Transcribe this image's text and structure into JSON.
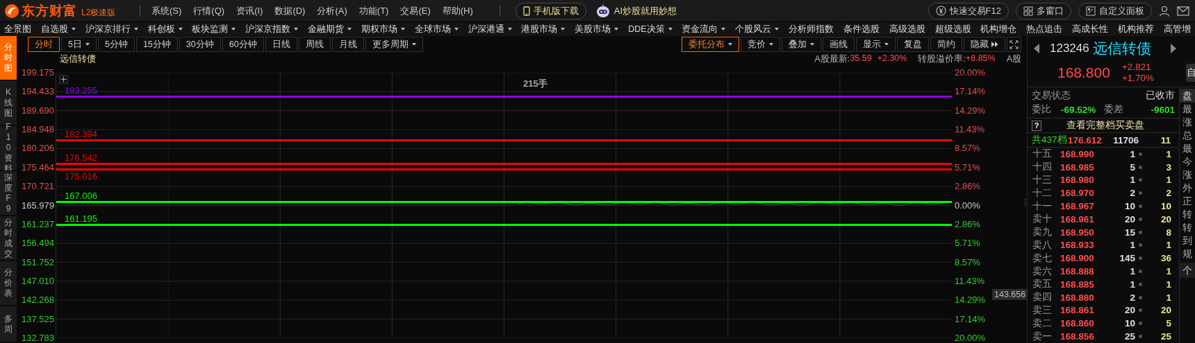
{
  "app": {
    "logo_text": "东方财富",
    "edition": "L2极速版"
  },
  "menu": [
    "系统(S)",
    "行情(Q)",
    "资讯(I)",
    "数据(D)",
    "分析(A)",
    "功能(T)",
    "交易(E)",
    "帮助(H)"
  ],
  "promo_buttons": [
    {
      "label": "手机版下载",
      "kind": "phone"
    },
    {
      "label": "AI炒股就用妙想",
      "kind": "robot"
    }
  ],
  "tool_buttons": [
    {
      "label": "快速交易F12",
      "kind": "trade"
    },
    {
      "label": "多窗口",
      "kind": "windows"
    },
    {
      "label": "自定义面板",
      "kind": "panel"
    }
  ],
  "nav": [
    {
      "label": "全景图",
      "dropdown": false
    },
    {
      "label": "自选股",
      "dropdown": true
    },
    {
      "label": "沪深京排行",
      "dropdown": true
    },
    {
      "label": "科创板",
      "dropdown": true
    },
    {
      "label": "板块监测",
      "dropdown": true
    },
    {
      "label": "沪深京指数",
      "dropdown": true
    },
    {
      "label": "金融期货",
      "dropdown": true
    },
    {
      "label": "期权市场",
      "dropdown": true
    },
    {
      "label": "全球市场",
      "dropdown": true
    },
    {
      "label": "沪深港通",
      "dropdown": true
    },
    {
      "label": "港股市场",
      "dropdown": true
    },
    {
      "label": "美股市场",
      "dropdown": true
    },
    {
      "label": "DDE决策",
      "dropdown": true
    },
    {
      "label": "资金流向",
      "dropdown": true
    },
    {
      "label": "个股风云",
      "dropdown": true
    },
    {
      "label": "分析师指数",
      "dropdown": false
    },
    {
      "label": "条件选股",
      "dropdown": false
    },
    {
      "label": "高级选股",
      "dropdown": false
    },
    {
      "label": "超级选股",
      "dropdown": false
    },
    {
      "label": "机构增仓",
      "dropdown": false
    },
    {
      "label": "热点追击",
      "dropdown": false
    },
    {
      "label": "高成长性",
      "dropdown": false
    },
    {
      "label": "机构推荐",
      "dropdown": false
    },
    {
      "label": "高管增",
      "dropdown": false
    }
  ],
  "sidebar_tabs": [
    {
      "label": "分时图",
      "selected": true
    },
    {
      "label": "K线图",
      "selected": false
    },
    {
      "label": "F10资料",
      "selected": false
    },
    {
      "label": "深度F9",
      "selected": false
    },
    {
      "label": "分时成交",
      "selected": false
    },
    {
      "label": "分价表",
      "selected": false
    },
    {
      "label": "多周",
      "selected": false
    }
  ],
  "periods": [
    {
      "label": "分时",
      "selected": true,
      "dropdown": false
    },
    {
      "label": "5日",
      "selected": false,
      "dropdown": true
    },
    {
      "label": "5分钟",
      "selected": false,
      "dropdown": false
    },
    {
      "label": "15分钟",
      "selected": false,
      "dropdown": false
    },
    {
      "label": "30分钟",
      "selected": false,
      "dropdown": false
    },
    {
      "label": "60分钟",
      "selected": false,
      "dropdown": false
    },
    {
      "label": "日线",
      "selected": false,
      "dropdown": false
    },
    {
      "label": "周线",
      "selected": false,
      "dropdown": false
    },
    {
      "label": "月线",
      "selected": false,
      "dropdown": false
    },
    {
      "label": "更多周期",
      "selected": false,
      "dropdown": true
    }
  ],
  "chart_tools": [
    {
      "label": "委托分布",
      "selected": true,
      "dropdown": true
    },
    {
      "label": "竞价",
      "selected": false,
      "dropdown": true
    },
    {
      "label": "叠加",
      "selected": false,
      "dropdown": true
    },
    {
      "label": "画线",
      "selected": false,
      "dropdown": false
    },
    {
      "label": "显示",
      "selected": false,
      "dropdown": true
    },
    {
      "label": "复盘",
      "selected": false,
      "dropdown": false
    },
    {
      "label": "简约",
      "selected": false,
      "dropdown": false
    },
    {
      "label": "隐藏",
      "selected": false,
      "dropdown": false
    }
  ],
  "chart": {
    "title": "远信转债",
    "info": [
      {
        "text": "A股最新:",
        "color": "#b4b4b4"
      },
      {
        "text": "35.59",
        "color": "#ff5050"
      },
      {
        "text": "+2.30%",
        "color": "#ff5050"
      },
      {
        "text": "转股溢价率:",
        "color": "#b4b4b4"
      },
      {
        "text": "+8.85%",
        "color": "#ff5050"
      },
      {
        "text": "A股",
        "color": "#b4b4b4"
      }
    ],
    "volume": "215手",
    "price_ticks": [
      {
        "label": "199.175",
        "color": "#e05050"
      },
      {
        "label": "194.433",
        "color": "#e05050"
      },
      {
        "label": "189.690",
        "color": "#e05050"
      },
      {
        "label": "184.948",
        "color": "#e05050"
      },
      {
        "label": "180.206",
        "color": "#e05050"
      },
      {
        "label": "175.464",
        "color": "#e05050"
      },
      {
        "label": "170.721",
        "color": "#e05050"
      },
      {
        "label": "165.979",
        "color": "#c8c8c8"
      },
      {
        "label": "161.237",
        "color": "#33cc33"
      },
      {
        "label": "156.494",
        "color": "#33cc33"
      },
      {
        "label": "151.752",
        "color": "#33cc33"
      },
      {
        "label": "147.010",
        "color": "#33cc33"
      },
      {
        "label": "142.268",
        "color": "#33cc33"
      },
      {
        "label": "137.525",
        "color": "#33cc33"
      },
      {
        "label": "132.783",
        "color": "#33cc33"
      }
    ],
    "pct_ticks": [
      {
        "label": "20.00%",
        "color": "#e05050"
      },
      {
        "label": "17.14%",
        "color": "#e05050"
      },
      {
        "label": "14.29%",
        "color": "#e05050"
      },
      {
        "label": "11.43%",
        "color": "#e05050"
      },
      {
        "label": "8.57%",
        "color": "#e05050"
      },
      {
        "label": "5.71%",
        "color": "#e05050"
      },
      {
        "label": "2.86%",
        "color": "#e05050"
      },
      {
        "label": "0.00%",
        "color": "#c8c8c8"
      },
      {
        "label": "2.86%",
        "color": "#33cc33"
      },
      {
        "label": "5.71%",
        "color": "#33cc33"
      },
      {
        "label": "8.57%",
        "color": "#33cc33"
      },
      {
        "label": "11.43%",
        "color": "#33cc33"
      },
      {
        "label": "14.29%",
        "color": "#33cc33"
      },
      {
        "label": "17.14%",
        "color": "#33cc33"
      },
      {
        "label": "20.00%",
        "color": "#33cc33"
      }
    ],
    "levels": [
      {
        "label": "193.255",
        "color": "#8a00ff"
      },
      {
        "label": "182.394",
        "color": "#ff0000"
      },
      {
        "label": "176.542",
        "color": "#ff0000"
      },
      {
        "label": "175.016",
        "color": "#ff0000"
      },
      {
        "label": "167.006",
        "color": "#00ff00"
      },
      {
        "label": "161.195",
        "color": "#00ff00"
      }
    ],
    "cursor_price": "143.656"
  },
  "quote": {
    "code": "123246",
    "name": "远信转债",
    "price": "168.800",
    "change": "+2.821",
    "change_pct": "+1.70%",
    "side_button": "自"
  },
  "status": {
    "label": "交易状态",
    "value": "已收市"
  },
  "ratio": {
    "label": "委比",
    "value": "-69.52%",
    "diff_label": "委差",
    "diff_value": "-9601"
  },
  "full_book": {
    "help": "?",
    "label": "查看完整档买卖盘"
  },
  "summary": {
    "label": "共437档",
    "price": "176.612",
    "volume": "11706",
    "count": "11"
  },
  "asks": [
    {
      "rank": "十五",
      "price": "168.990",
      "volume": "1",
      "orders": "1"
    },
    {
      "rank": "十四",
      "price": "168.985",
      "volume": "5",
      "orders": "3"
    },
    {
      "rank": "十三",
      "price": "168.980",
      "volume": "1",
      "orders": "1"
    },
    {
      "rank": "十二",
      "price": "168.970",
      "volume": "2",
      "orders": "2"
    },
    {
      "rank": "十一",
      "price": "168.967",
      "volume": "10",
      "orders": "10"
    },
    {
      "rank": "卖十",
      "price": "168.961",
      "volume": "20",
      "orders": "20"
    },
    {
      "rank": "卖九",
      "price": "168.950",
      "volume": "15",
      "orders": "8"
    },
    {
      "rank": "卖八",
      "price": "168.933",
      "volume": "1",
      "orders": "1"
    },
    {
      "rank": "卖七",
      "price": "168.900",
      "volume": "145",
      "orders": "36"
    },
    {
      "rank": "卖六",
      "price": "168.888",
      "volume": "1",
      "orders": "1"
    },
    {
      "rank": "卖五",
      "price": "168.885",
      "volume": "1",
      "orders": "1"
    },
    {
      "rank": "卖四",
      "price": "168.880",
      "volume": "2",
      "orders": "1"
    },
    {
      "rank": "卖三",
      "price": "168.861",
      "volume": "20",
      "orders": "20"
    },
    {
      "rank": "卖二",
      "price": "168.860",
      "volume": "10",
      "orders": "5"
    },
    {
      "rank": "卖一",
      "price": "168.856",
      "volume": "25",
      "orders": "25"
    }
  ],
  "side_panel": {
    "tab": "盘",
    "items": [
      "最",
      "涨",
      "总",
      "最",
      "今",
      "涨",
      "外",
      "正",
      "转",
      "转",
      "到",
      "规"
    ],
    "footer": "个"
  }
}
